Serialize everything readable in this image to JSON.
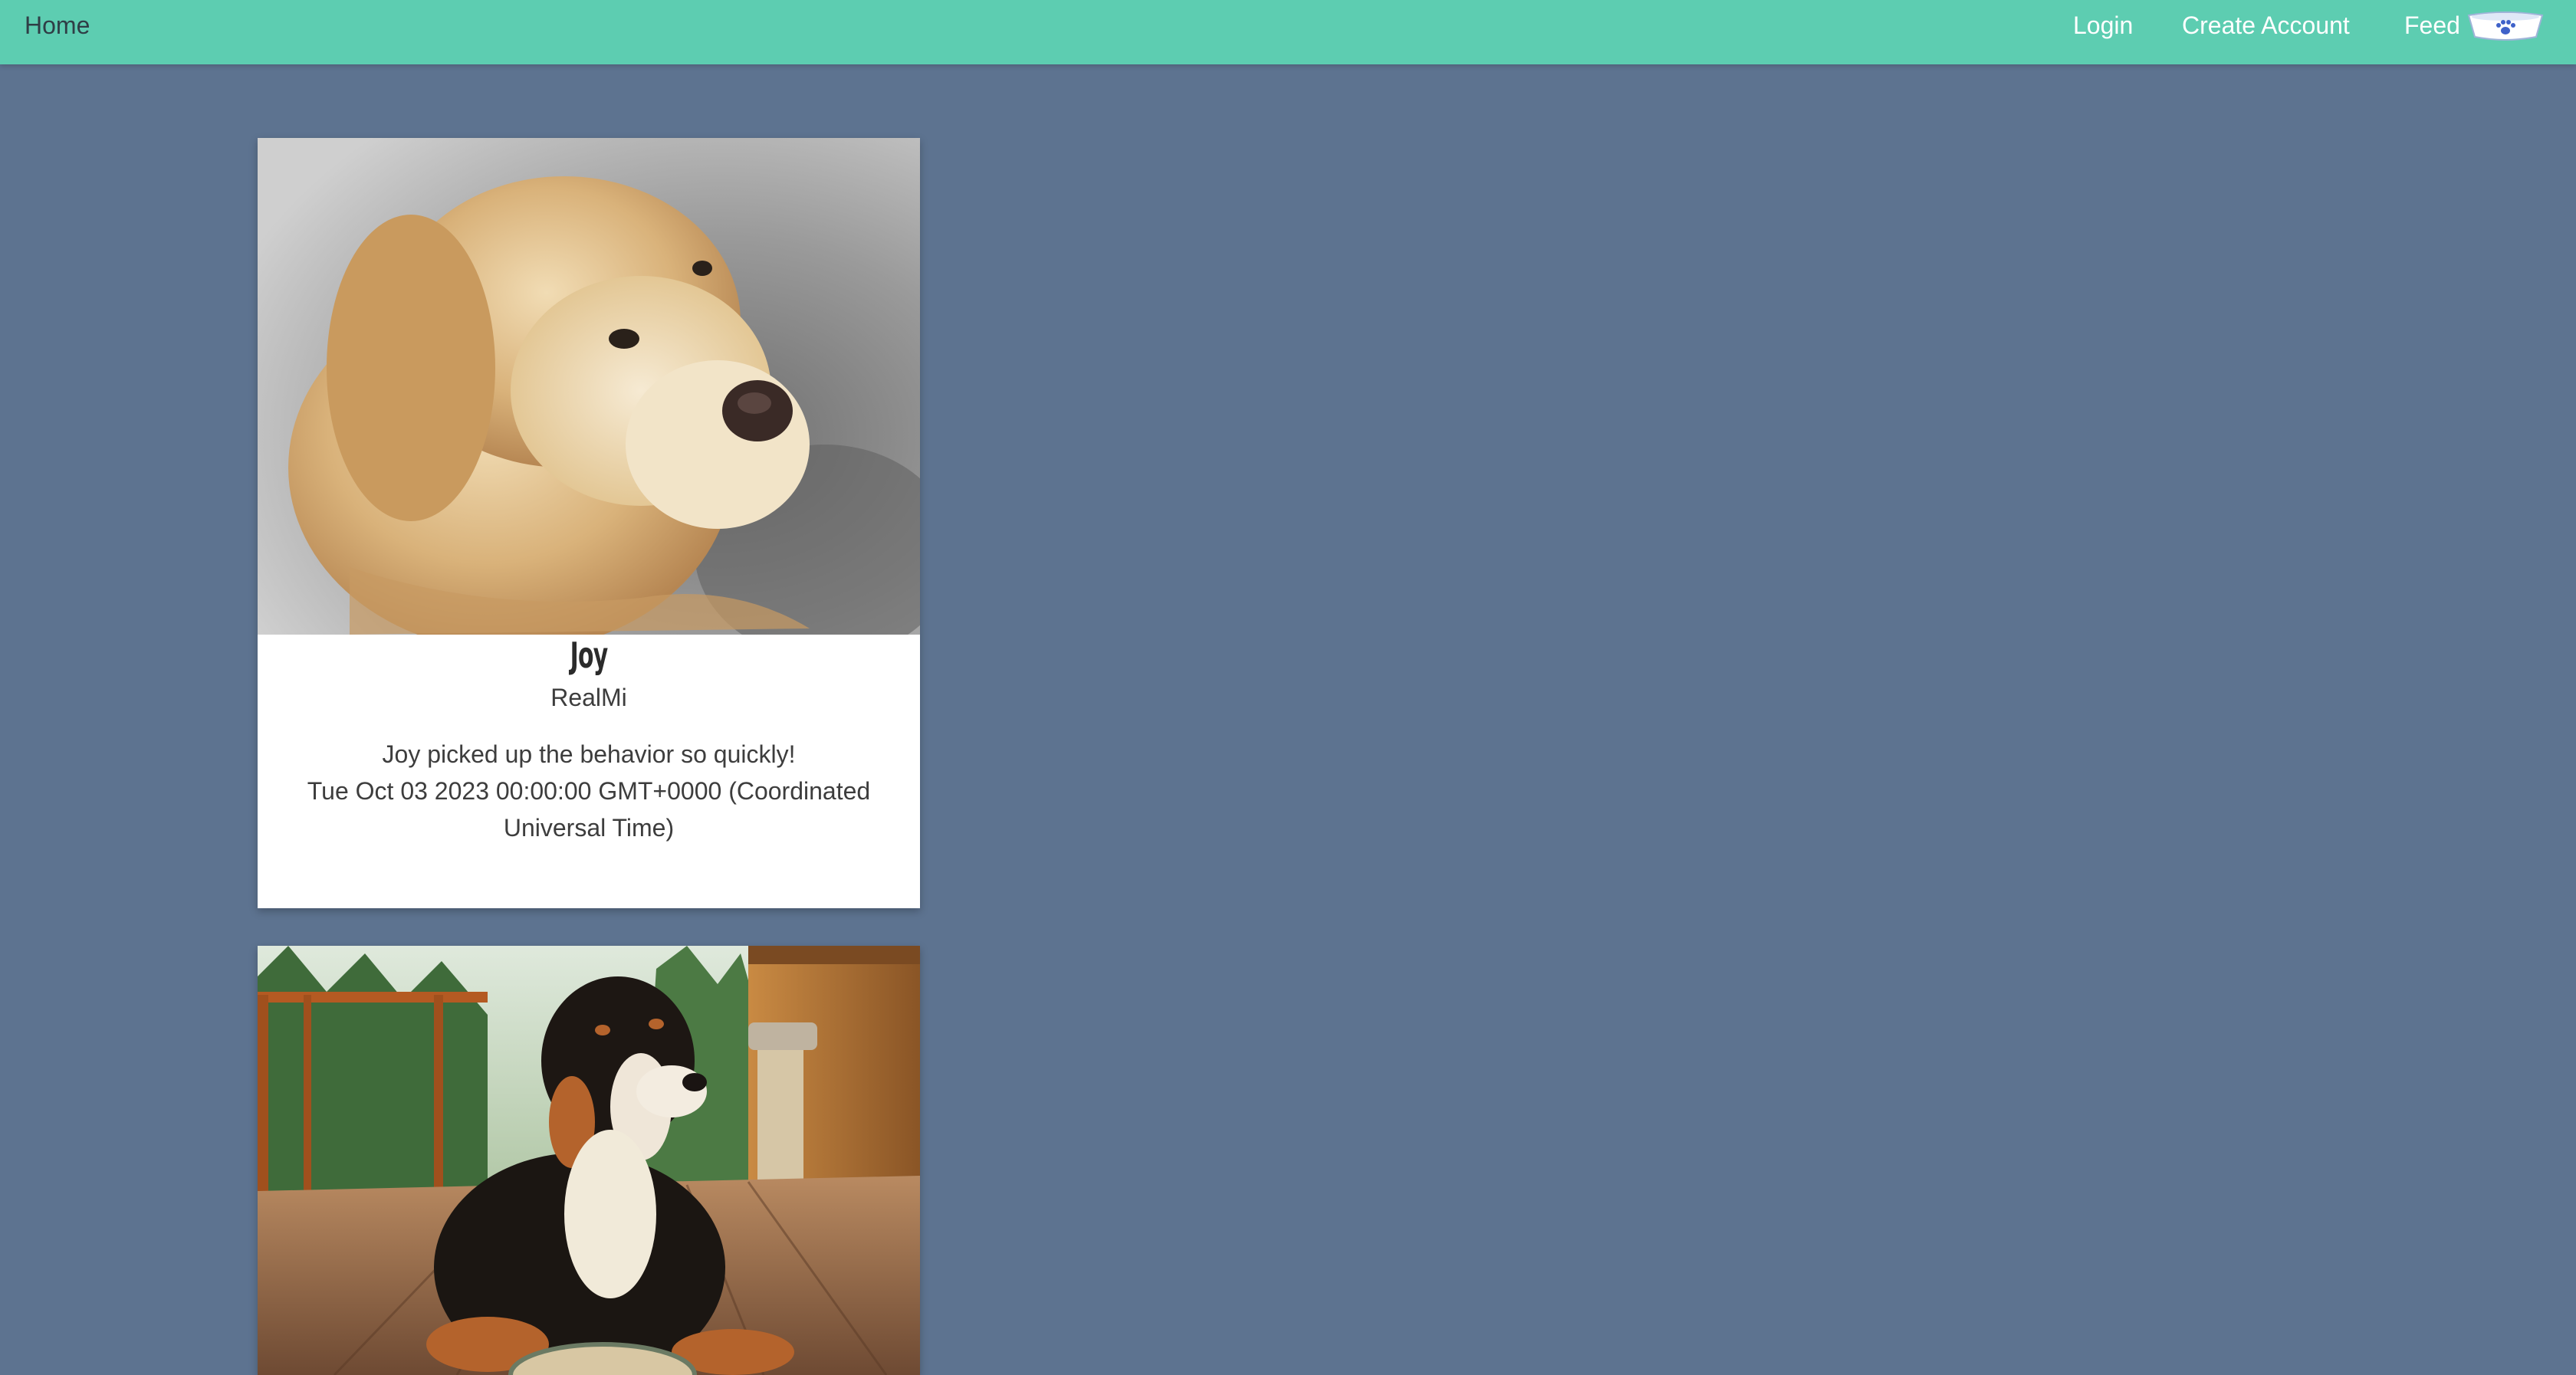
{
  "nav": {
    "home": "Home",
    "login": "Login",
    "create_account": "Create Account",
    "feed": "Feed",
    "feed_icon": "dog-bowl-icon"
  },
  "colors": {
    "navbar": "#5dcdb1",
    "background": "#5d7390",
    "card": "#ffffff"
  },
  "posts": [
    {
      "pet_name": "Joy",
      "owner": "RealMi",
      "caption": "Joy picked up the behavior so quickly!",
      "date": "Tue Oct 03 2023 00:00:00 GMT+0000 (Coordinated Universal Time)",
      "photo": "golden-doodle-puppy-photo"
    },
    {
      "photo": "bernese-mountain-dog-photo"
    }
  ]
}
